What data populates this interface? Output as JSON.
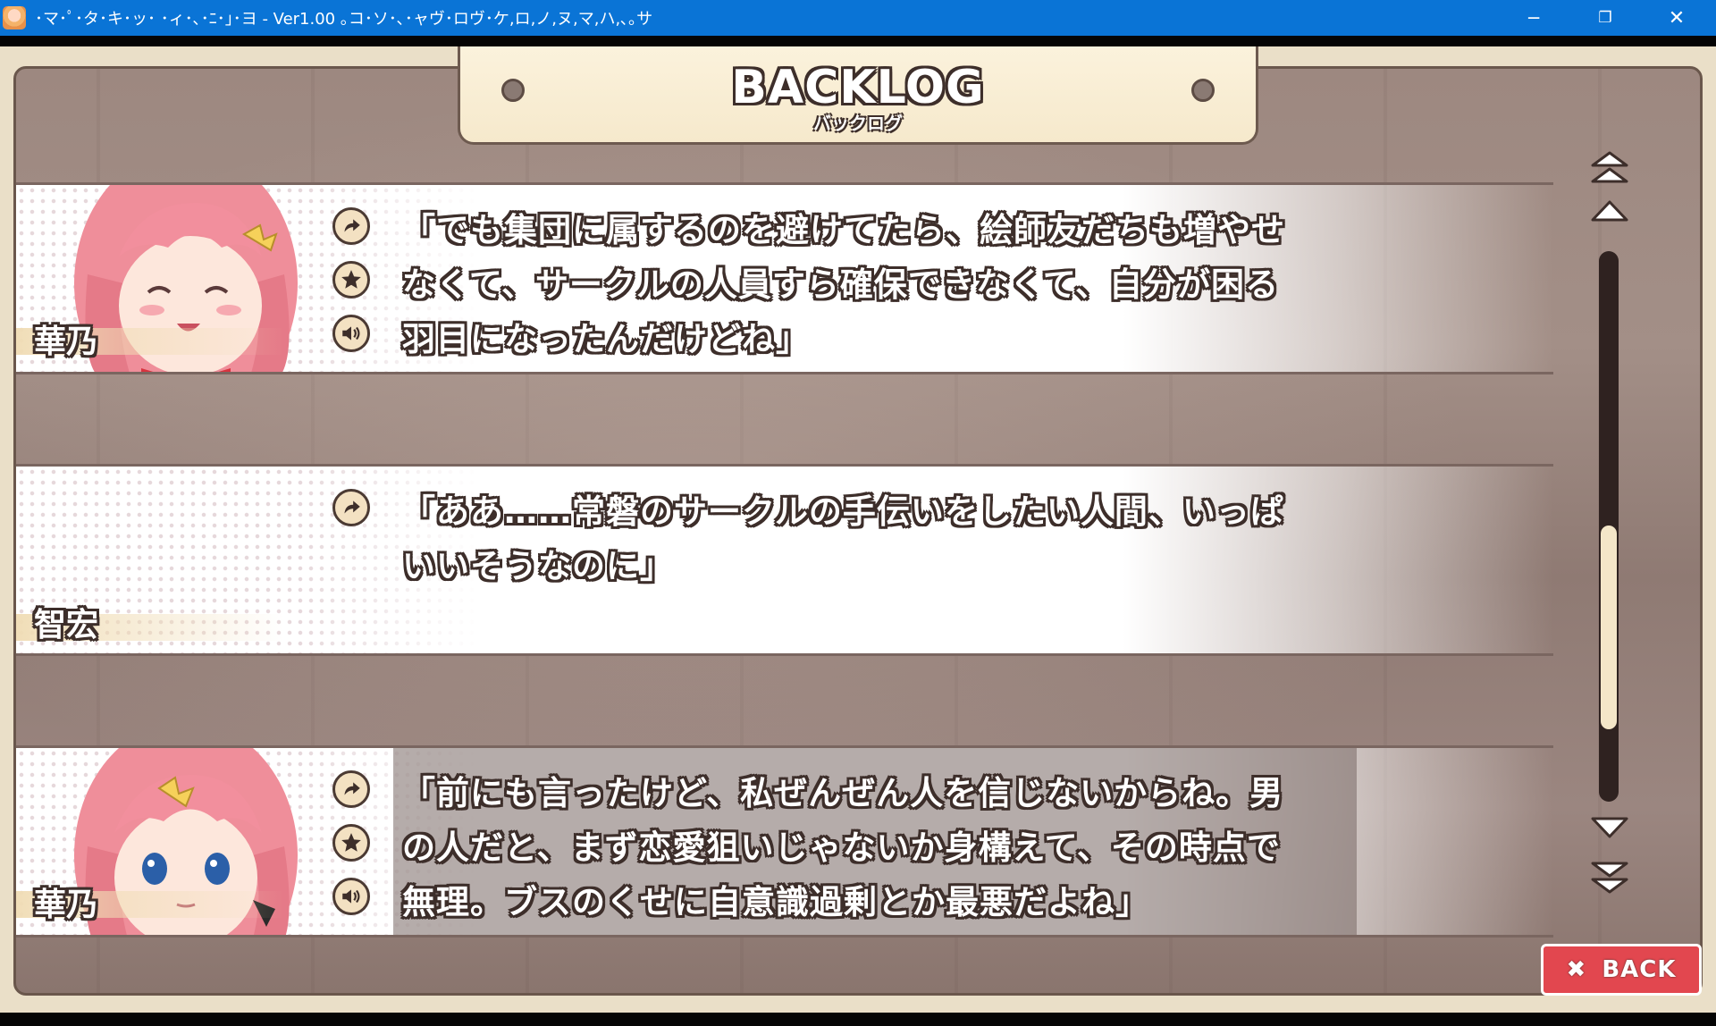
{
  "window": {
    "title": "･マ･ﾟ･タ･キ･ッ･ ･ィ･､･ﾆ･｣･ヨ - Ver1.00 ｡コ･ソ･､･ャヴ･ロヴ･ケ,ロ,ノ,ヌ,マ,ハ,､｡サ",
    "minimize": "─",
    "restore": "❐",
    "close": "✕"
  },
  "header": {
    "title": "BACKLOG",
    "subtitle": "バックログ"
  },
  "entries": [
    {
      "speaker": "華乃",
      "lines": [
        "「でも集団に属するのを避けてたら、絵師友だちも増やせ",
        "なくて、サークルの人員すら確保できなくて、自分が困る",
        "羽目になったんだけどね」"
      ]
    },
    {
      "speaker": "智宏",
      "lines": [
        "「ああ……常磐のサークルの手伝いをしたい人間、いっぱ",
        "いいそうなのに」"
      ]
    },
    {
      "speaker": "華乃",
      "lines": [
        "「前にも言ったけど、私ぜんぜん人を信じないからね。男",
        "の人だと、まず恋愛狙いじゃないか身構えて、その時点で",
        "無理。ブスのくせに自意識過剰とか最悪だよね」"
      ]
    }
  ],
  "controls": {
    "back_label": "BACK",
    "back_icon": "✖",
    "scroll_position": 0.62
  },
  "icons": {
    "jump": "jump-arrow-icon",
    "favorite": "star-icon",
    "voice": "speaker-icon"
  },
  "colors": {
    "accent": "#e2474f",
    "titlebar": "#0a74d6",
    "panel": "#f6e9cc"
  }
}
